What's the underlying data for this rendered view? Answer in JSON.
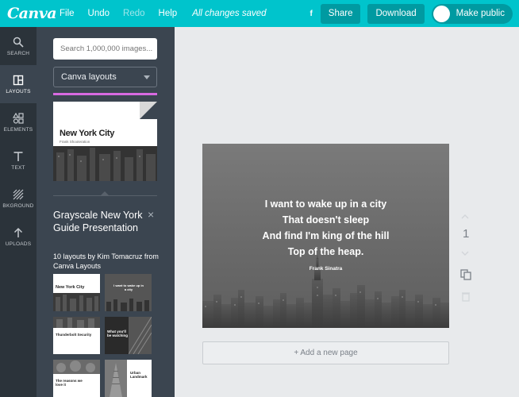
{
  "app": {
    "logo": "Canva"
  },
  "menu": {
    "file": "File",
    "undo": "Undo",
    "redo": "Redo",
    "help": "Help",
    "status": "All changes saved"
  },
  "toolbar": {
    "f_mark": "f",
    "share": "Share",
    "download": "Download",
    "make_public": "Make public"
  },
  "rail": {
    "search": "SEARCH",
    "layouts": "LAYOUTS",
    "elements": "ELEMENTS",
    "text": "TEXT",
    "background": "BKGROUND",
    "uploads": "UPLOADS"
  },
  "panel": {
    "search_placeholder": "Search 1,000,000 images...",
    "layout_select": "Canva layouts",
    "thumb_title": "New York City",
    "thumb_subtitle": "Frank Shooteration",
    "title": "Grayscale New York Guide Presentation",
    "close": "×",
    "subtitle": "10 layouts by Kim Tomacruz from Canva Layouts",
    "thumbs": {
      "t1": "New York City",
      "t2": "I want to wake up in a city",
      "t3": "Thunderbolt Security",
      "t4": "What you'll be watching",
      "t5": "Urban Landmark",
      "t6": "The reasons we love it"
    }
  },
  "design": {
    "quote_lines": [
      "I want to wake up in a city",
      "That doesn't sleep",
      "And find I'm king of the hill",
      "Top of the heap."
    ],
    "author": "Frank Sinatra"
  },
  "canvas": {
    "add_page": "+ Add a new page",
    "page_number": "1"
  },
  "colors": {
    "brand": "#00c4cc",
    "rail": "#2b333a",
    "panel": "#3b4550",
    "accent_pink": "#d86ae0"
  }
}
